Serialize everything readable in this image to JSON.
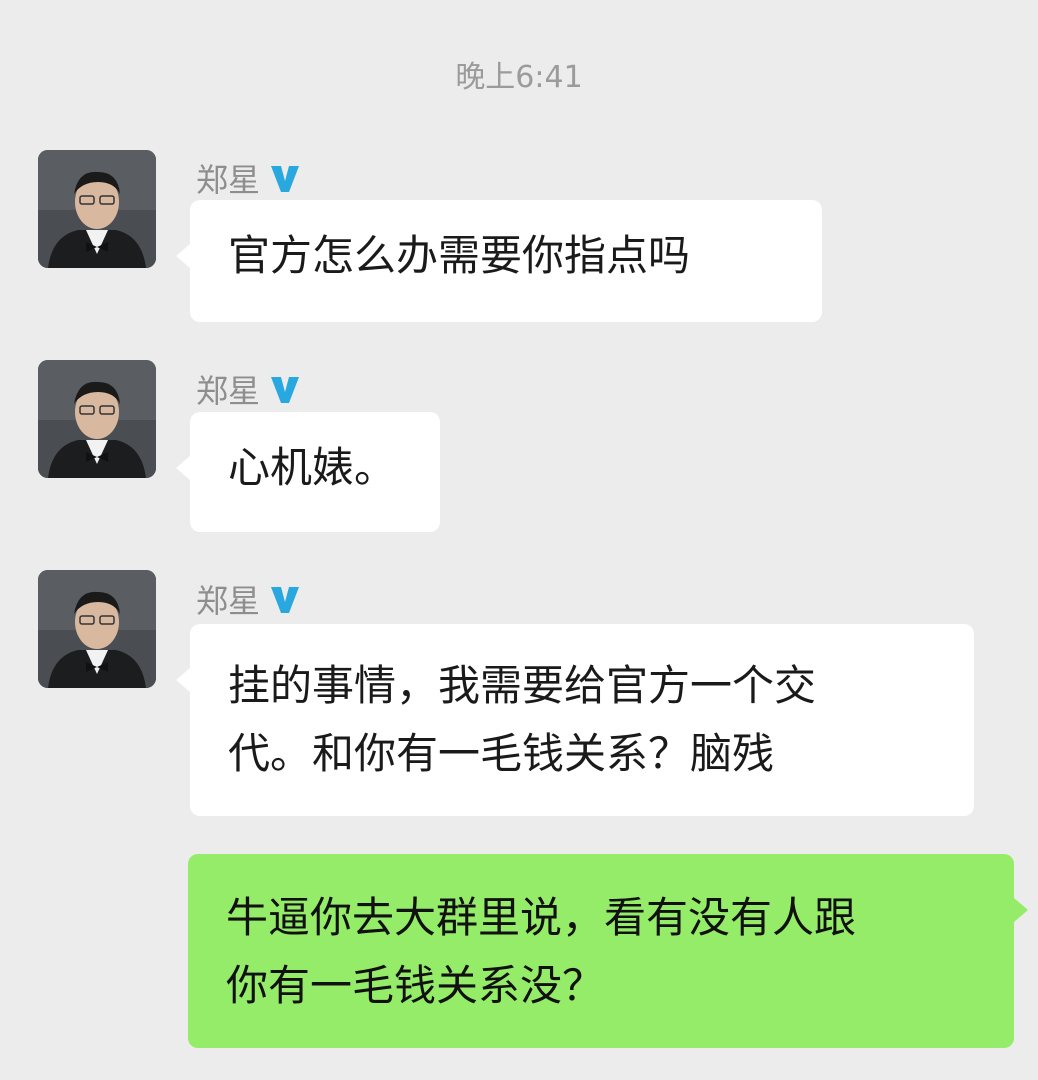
{
  "timestamp": "晚上6:41",
  "messages": [
    {
      "sender": "郑星",
      "verified_icon": "verified-v-icon",
      "text": "官方怎么办需要你指点吗"
    },
    {
      "sender": "郑星",
      "verified_icon": "verified-v-icon",
      "text": "心机婊。"
    },
    {
      "sender": "郑星",
      "verified_icon": "verified-v-icon",
      "line1": "挂的事情，我需要给官方一个交",
      "line2": "代。和你有一毛钱关系？脑残"
    },
    {
      "sender": "self",
      "line1": "牛逼你去大群里说，看有没有人跟",
      "line2": "你有一毛钱关系没？"
    }
  ],
  "colors": {
    "background": "#ececec",
    "bubble_incoming": "#ffffff",
    "bubble_outgoing": "#95ec69",
    "verified": "#29a8e0"
  }
}
